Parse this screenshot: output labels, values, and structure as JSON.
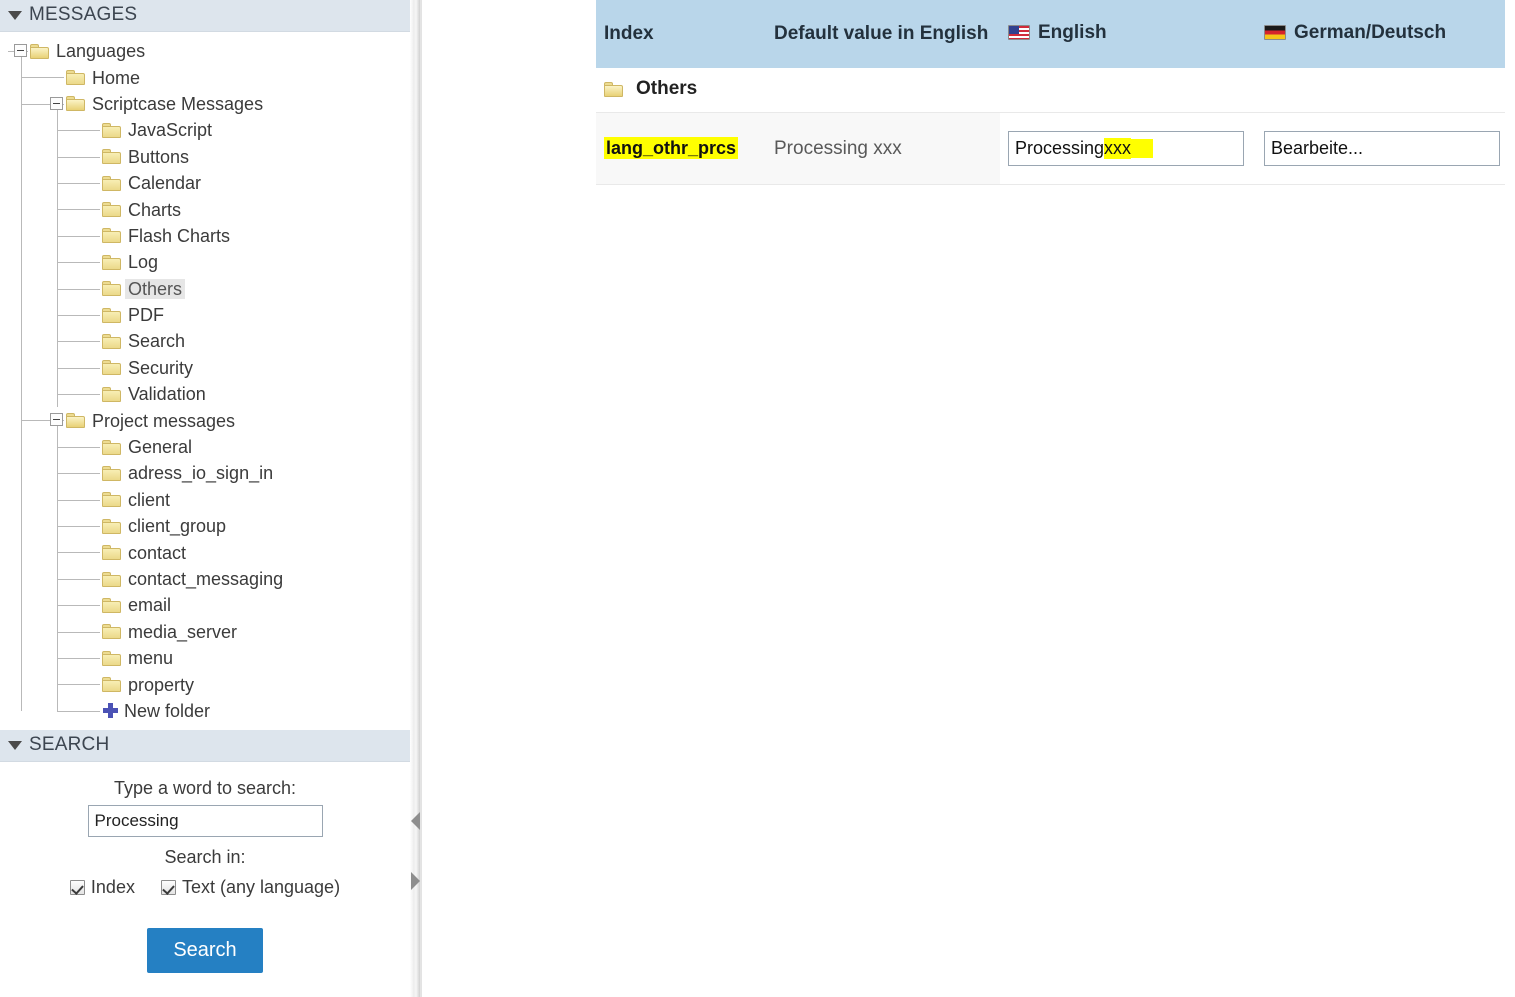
{
  "sidebar": {
    "messages_panel": {
      "title": "MESSAGES",
      "caret_icon": "caret-down-icon",
      "tree": [
        {
          "label": "Languages",
          "depth": 0,
          "icon": "folder-open-icon",
          "expander": "minus",
          "selected": false
        },
        {
          "label": "Home",
          "depth": 1,
          "icon": "folder-icon",
          "expander": "none",
          "selected": false
        },
        {
          "label": "Scriptcase Messages",
          "depth": 1,
          "icon": "folder-open-icon",
          "expander": "minus",
          "selected": false
        },
        {
          "label": "JavaScript",
          "depth": 2,
          "icon": "folder-icon",
          "expander": "none",
          "selected": false
        },
        {
          "label": "Buttons",
          "depth": 2,
          "icon": "folder-icon",
          "expander": "none",
          "selected": false
        },
        {
          "label": "Calendar",
          "depth": 2,
          "icon": "folder-icon",
          "expander": "none",
          "selected": false
        },
        {
          "label": "Charts",
          "depth": 2,
          "icon": "folder-icon",
          "expander": "none",
          "selected": false
        },
        {
          "label": "Flash Charts",
          "depth": 2,
          "icon": "folder-icon",
          "expander": "none",
          "selected": false
        },
        {
          "label": "Log",
          "depth": 2,
          "icon": "folder-icon",
          "expander": "none",
          "selected": false
        },
        {
          "label": "Others",
          "depth": 2,
          "icon": "folder-icon",
          "expander": "none",
          "selected": true
        },
        {
          "label": "PDF",
          "depth": 2,
          "icon": "folder-icon",
          "expander": "none",
          "selected": false
        },
        {
          "label": "Search",
          "depth": 2,
          "icon": "folder-icon",
          "expander": "none",
          "selected": false
        },
        {
          "label": "Security",
          "depth": 2,
          "icon": "folder-icon",
          "expander": "none",
          "selected": false
        },
        {
          "label": "Validation",
          "depth": 2,
          "icon": "folder-icon",
          "expander": "none",
          "selected": false
        },
        {
          "label": "Project messages",
          "depth": 1,
          "icon": "folder-open-icon",
          "expander": "minus",
          "selected": false
        },
        {
          "label": "General",
          "depth": 2,
          "icon": "folder-icon",
          "expander": "none",
          "selected": false
        },
        {
          "label": "adress_io_sign_in",
          "depth": 2,
          "icon": "folder-icon",
          "expander": "none",
          "selected": false
        },
        {
          "label": "client",
          "depth": 2,
          "icon": "folder-icon",
          "expander": "none",
          "selected": false
        },
        {
          "label": "client_group",
          "depth": 2,
          "icon": "folder-icon",
          "expander": "none",
          "selected": false
        },
        {
          "label": "contact",
          "depth": 2,
          "icon": "folder-icon",
          "expander": "none",
          "selected": false
        },
        {
          "label": "contact_messaging",
          "depth": 2,
          "icon": "folder-icon",
          "expander": "none",
          "selected": false
        },
        {
          "label": "email",
          "depth": 2,
          "icon": "folder-icon",
          "expander": "none",
          "selected": false
        },
        {
          "label": "media_server",
          "depth": 2,
          "icon": "folder-icon",
          "expander": "none",
          "selected": false
        },
        {
          "label": "menu",
          "depth": 2,
          "icon": "folder-icon",
          "expander": "none",
          "selected": false
        },
        {
          "label": "property",
          "depth": 2,
          "icon": "folder-icon",
          "expander": "none",
          "selected": false
        },
        {
          "label": "New folder",
          "depth": 2,
          "icon": "plus-icon",
          "expander": "none",
          "selected": false
        }
      ]
    },
    "search_panel": {
      "title": "SEARCH",
      "caret_icon": "caret-down-icon",
      "word_label": "Type a word to search:",
      "word_value": "Processing",
      "word_placeholder": "",
      "search_in_label": "Search in:",
      "checkboxes": [
        {
          "label": "Index",
          "checked": true
        },
        {
          "label": "Text (any language)",
          "checked": true
        }
      ],
      "button_label": "Search",
      "button_color": "#2580c3"
    }
  },
  "splitter": {
    "collapse_icon": "arrow-left-icon",
    "expand_icon": "arrow-right-icon"
  },
  "main": {
    "table": {
      "columns": [
        {
          "key": "index",
          "label": "Index",
          "flag": null
        },
        {
          "key": "default",
          "label": "Default value in English",
          "flag": null
        },
        {
          "key": "english",
          "label": "English",
          "flag": "us-flag-icon"
        },
        {
          "key": "german",
          "label": "German/Deutsch",
          "flag": "de-flag-icon"
        }
      ],
      "group_row": {
        "icon": "folder-icon",
        "label": "Others"
      },
      "rows": [
        {
          "index": "lang_othr_prcs",
          "index_highlighted": true,
          "default_value": "Processing xxx",
          "english_value_prefix": "Processing ",
          "english_value_highlight": "xxx",
          "german_value": "Bearbeite..."
        }
      ]
    },
    "colors": {
      "header_bg": "#b9d6ea",
      "highlight": "#ffff00",
      "row_bg": "#f8f8f8"
    }
  }
}
